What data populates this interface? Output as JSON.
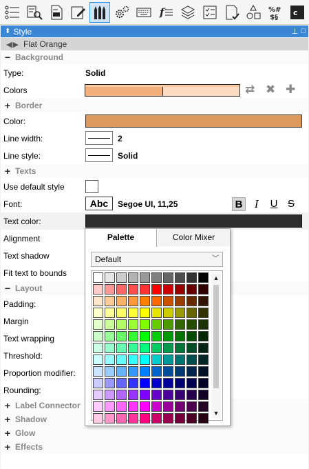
{
  "toolbar": {
    "icons": [
      "properties-icon",
      "search-list-icon",
      "document-icon",
      "edit-icon",
      "style-icon",
      "settings-icon",
      "keyboard-icon",
      "function-icon",
      "layers-icon",
      "checklist-icon",
      "check-document-icon",
      "shapes-icon",
      "symbols-icon",
      "code-icon"
    ]
  },
  "panel": {
    "title": "Style",
    "theme_name": "Flat Orange"
  },
  "background": {
    "section_title": "Background",
    "type_label": "Type:",
    "type_value": "Solid",
    "colors_label": "Colors",
    "color_a": "#f4b07a",
    "color_b": "#fbdcc3"
  },
  "border": {
    "section_title": "Border",
    "color_label": "Color:",
    "color_value": "#dd9a5c",
    "line_width_label": "Line width:",
    "line_width_value": "2",
    "line_style_label": "Line style:",
    "line_style_value": "Solid"
  },
  "texts": {
    "section_title": "Texts",
    "use_default_label": "Use default style",
    "font_label": "Font:",
    "font_preview": "Abc",
    "font_value": "Segoe UI, 11,25",
    "bold": "B",
    "italic": "I",
    "underline": "U",
    "strike": "S",
    "text_color_label": "Text color:",
    "text_color_value": "#2d2d2d",
    "alignment_label": "Alignment",
    "text_shadow_label": "Text shadow",
    "fit_text_label": "Fit text to bounds"
  },
  "layout": {
    "section_title": "Layout",
    "padding_label": "Padding:",
    "margin_label": "Margin",
    "text_wrapping_label": "Text wrapping",
    "threshold_label": "Threshold:",
    "proportion_label": "Proportion modifier:",
    "rounding_label": "Rounding:"
  },
  "collapsed_sections": {
    "label_connector": "Label Connector",
    "shadow": "Shadow",
    "glow": "Glow",
    "effects": "Effects"
  },
  "popup": {
    "tab_palette": "Palette",
    "tab_mixer": "Color Mixer",
    "dropdown_value": "Default",
    "palette_rows": [
      [
        "#ffffff",
        "#e6e6e6",
        "#cccccc",
        "#b3b3b3",
        "#999999",
        "#808080",
        "#666666",
        "#4d4d4d",
        "#333333",
        "#000000"
      ],
      [
        "#ffcccc",
        "#ff9999",
        "#ff6666",
        "#ff4d4d",
        "#ff3333",
        "#ff0000",
        "#cc0000",
        "#990000",
        "#660000",
        "#330000"
      ],
      [
        "#ffe5cc",
        "#ffcc99",
        "#ffb266",
        "#ff9933",
        "#ff8000",
        "#ff6600",
        "#cc5200",
        "#993d00",
        "#662900",
        "#331400"
      ],
      [
        "#ffffcc",
        "#ffff99",
        "#ffff66",
        "#ffff33",
        "#ffff00",
        "#e6e600",
        "#cccc00",
        "#999900",
        "#666600",
        "#333300"
      ],
      [
        "#e5ffcc",
        "#ccff99",
        "#b2ff66",
        "#99ff33",
        "#80ff00",
        "#66cc00",
        "#4d9900",
        "#336600",
        "#264d00",
        "#1a3300"
      ],
      [
        "#ccffcc",
        "#99ff99",
        "#66ff66",
        "#33ff33",
        "#00ff00",
        "#00cc00",
        "#009900",
        "#007300",
        "#004d00",
        "#002600"
      ],
      [
        "#ccffe5",
        "#99ffcc",
        "#66ffb2",
        "#33ff99",
        "#00ff80",
        "#00cc66",
        "#00994d",
        "#007339",
        "#004d26",
        "#002613"
      ],
      [
        "#ccffff",
        "#99ffff",
        "#66ffff",
        "#33ffff",
        "#00ffff",
        "#00cccc",
        "#009999",
        "#007373",
        "#004d4d",
        "#002626"
      ],
      [
        "#cce5ff",
        "#99ccff",
        "#66b2ff",
        "#3399ff",
        "#0080ff",
        "#0066cc",
        "#004d99",
        "#003973",
        "#00264d",
        "#001326"
      ],
      [
        "#ccccff",
        "#9999ff",
        "#6666ff",
        "#3333ff",
        "#0000ff",
        "#0000cc",
        "#000099",
        "#000073",
        "#00004d",
        "#000026"
      ],
      [
        "#e5ccff",
        "#cc99ff",
        "#b266ff",
        "#9933ff",
        "#8000ff",
        "#6600cc",
        "#4d0099",
        "#390073",
        "#26004d",
        "#130026"
      ],
      [
        "#ffccff",
        "#ff99ff",
        "#ff66ff",
        "#ff33ff",
        "#ff00ff",
        "#cc00cc",
        "#990099",
        "#730073",
        "#4d004d",
        "#260026"
      ],
      [
        "#ffcce5",
        "#ff99cc",
        "#ff66b2",
        "#ff3399",
        "#ff0080",
        "#cc0066",
        "#99004d",
        "#730039",
        "#4d0026",
        "#260013"
      ]
    ]
  }
}
